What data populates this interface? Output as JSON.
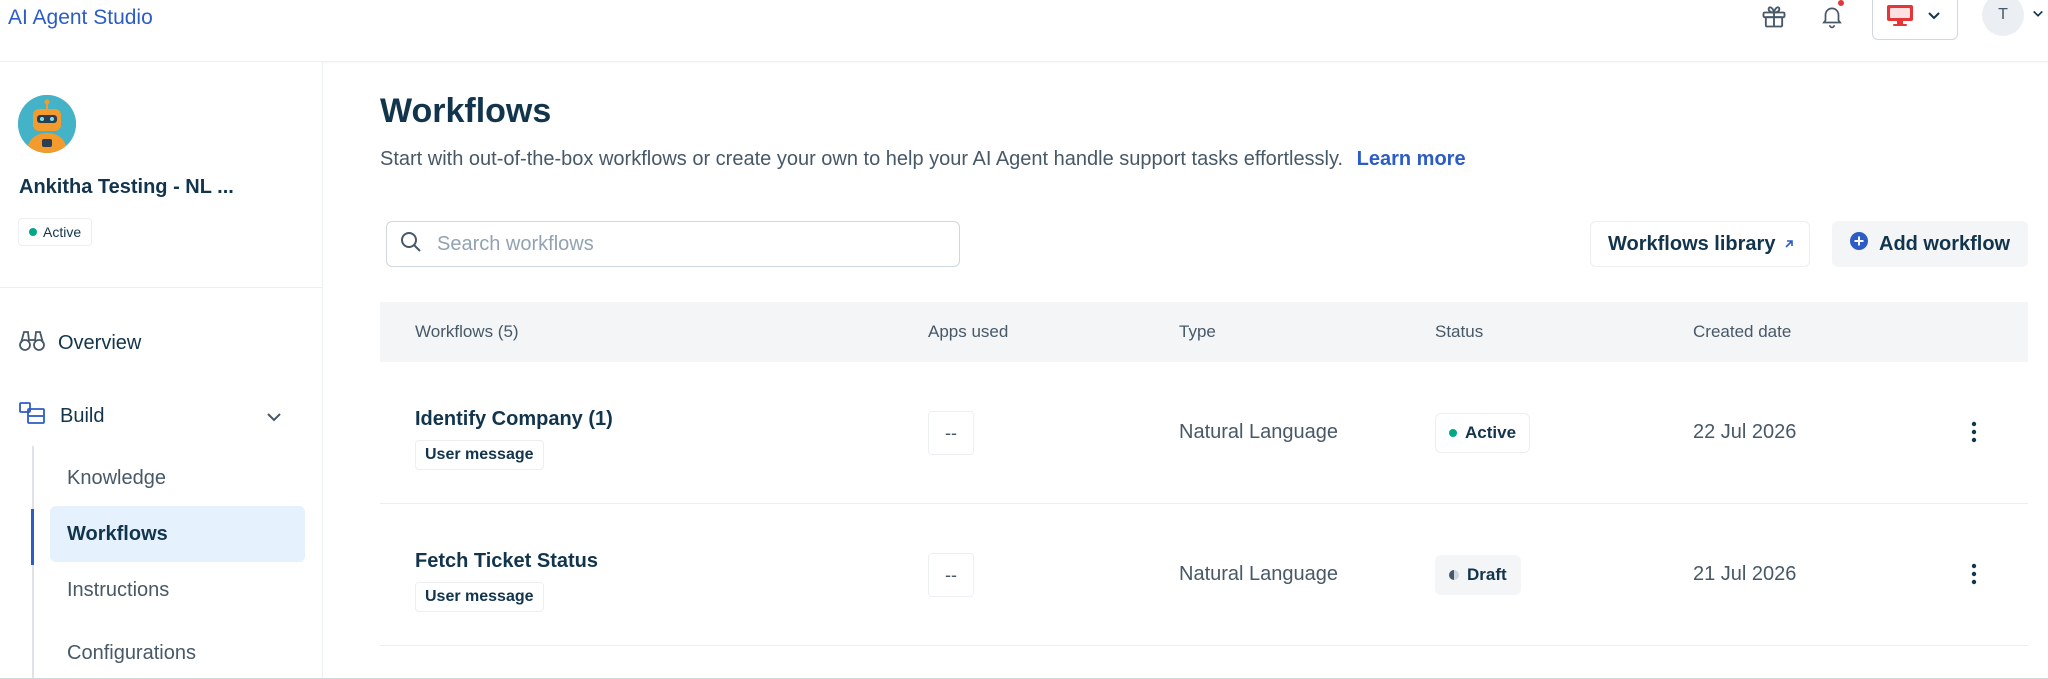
{
  "app": {
    "title": "AI Agent Studio"
  },
  "header": {
    "icons": [
      "gift-icon",
      "bell-icon",
      "monitor-icon",
      "chevron-down-icon"
    ],
    "user_initial": "T"
  },
  "sidebar": {
    "agent_name": "Ankitha Testing - NL ...",
    "agent_status": "Active",
    "nav": {
      "overview": "Overview",
      "build": "Build",
      "sub_items": [
        {
          "label": "Knowledge",
          "active": false
        },
        {
          "label": "Workflows",
          "active": true
        },
        {
          "label": "Instructions",
          "active": false
        },
        {
          "label": "Configurations",
          "active": false
        }
      ]
    }
  },
  "main": {
    "title": "Workflows",
    "description": "Start with out-of-the-box workflows or create your own to help your AI Agent handle support tasks effortlessly.",
    "learn_more": "Learn more",
    "search_placeholder": "Search workflows",
    "library_button": "Workflows library",
    "add_button": "Add workflow"
  },
  "table": {
    "headers": {
      "workflows": "Workflows (5)",
      "apps": "Apps used",
      "type": "Type",
      "status": "Status",
      "created": "Created date"
    },
    "rows": [
      {
        "name": "Identify Company (1)",
        "tag": "User message",
        "apps": "--",
        "type": "Natural Language",
        "status": "Active",
        "created": "22 Jul 2026"
      },
      {
        "name": "Fetch Ticket Status",
        "tag": "User message",
        "apps": "--",
        "type": "Natural Language",
        "status": "Draft",
        "created": "21 Jul 2026"
      }
    ]
  },
  "colors": {
    "accent": "#2c5cc5",
    "active_status": "#00a886",
    "text_primary": "#12344d",
    "text_secondary": "#475867"
  }
}
